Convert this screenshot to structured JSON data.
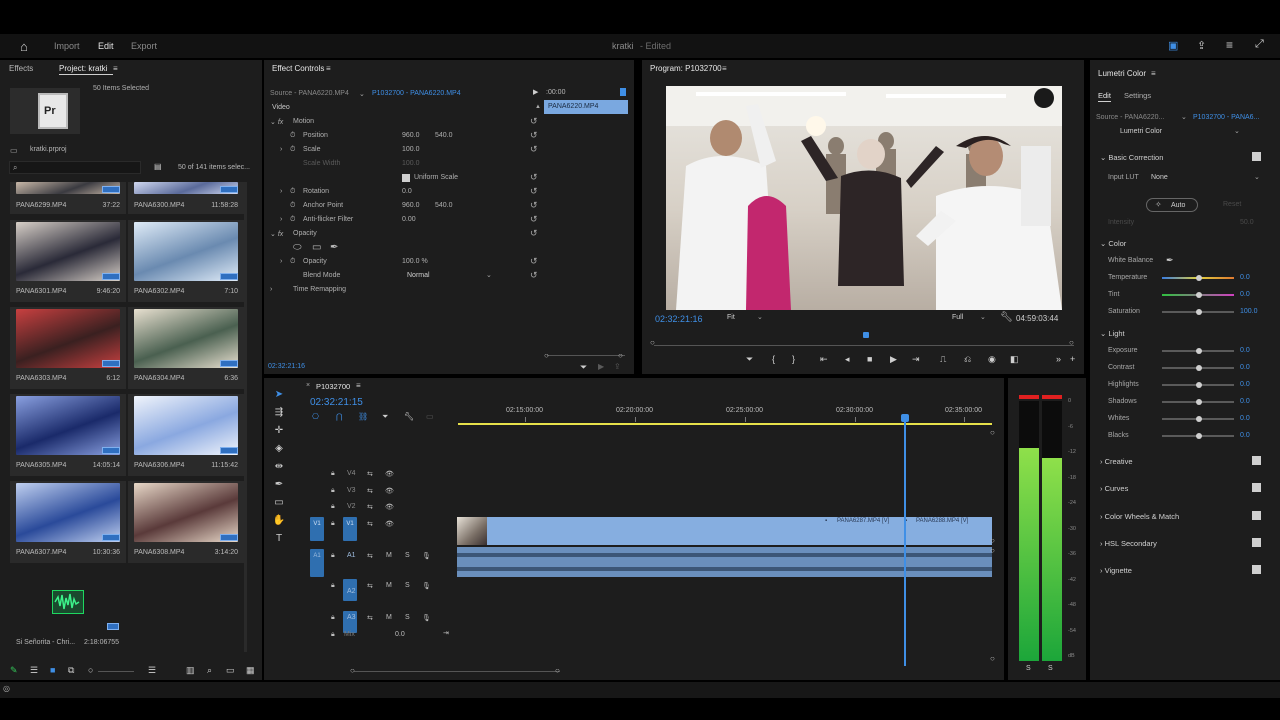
{
  "header": {
    "home": "Home",
    "import": "Import",
    "edit": "Edit",
    "export": "Export",
    "title": "kratki",
    "edited": "- Edited"
  },
  "project": {
    "tab_effects": "Effects",
    "tab_project": "Project: kratki",
    "selected": "50 Items Selected",
    "file": "kratki.prproj",
    "count": "50 of 141 items selec...",
    "items": [
      {
        "name": "PANA6299.MP4",
        "dur": "37:22"
      },
      {
        "name": "PANA6300.MP4",
        "dur": "11:58:28"
      },
      {
        "name": "PANA6301.MP4",
        "dur": "9:46:20"
      },
      {
        "name": "PANA6302.MP4",
        "dur": "7:10"
      },
      {
        "name": "PANA6303.MP4",
        "dur": "6:12"
      },
      {
        "name": "PANA6304.MP4",
        "dur": "6:36"
      },
      {
        "name": "PANA6305.MP4",
        "dur": "14:05:14"
      },
      {
        "name": "PANA6306.MP4",
        "dur": "11:15:42"
      },
      {
        "name": "PANA6307.MP4",
        "dur": "10:30:36"
      },
      {
        "name": "PANA6308.MP4",
        "dur": "3:14:20"
      }
    ],
    "audio_name": "Si Señorita - Chri...",
    "audio_dur": "2:18:06755"
  },
  "effects": {
    "tab": "Effect Controls",
    "source": "Source - PANA6220.MP4",
    "clip": "P1032700 - PANA6220.MP4",
    "time_start": ":00:00",
    "clip_label": "PANA6220.MP4",
    "video": "Video",
    "motion": "Motion",
    "position": "Position",
    "pos_x": "960.0",
    "pos_y": "540.0",
    "scale": "Scale",
    "scale_val": "100.0",
    "scale_width": "Scale Width",
    "scale_width_val": "100.0",
    "uniform": "Uniform Scale",
    "rotation": "Rotation",
    "rotation_val": "0.0",
    "anchor": "Anchor Point",
    "anc_x": "960.0",
    "anc_y": "540.0",
    "antiflicker": "Anti-flicker Filter",
    "antiflicker_val": "0.00",
    "opacity_group": "Opacity",
    "opacity": "Opacity",
    "opacity_val": "100.0 %",
    "blend": "Blend Mode",
    "blend_val": "Normal",
    "time_remap": "Time Remapping",
    "timecode": "02:32:21:16"
  },
  "program": {
    "tab": "Program: P1032700",
    "timecode": "02:32:21:16",
    "fit": "Fit",
    "full": "Full",
    "duration": "04:59:03:44"
  },
  "timeline": {
    "tab": "P1032700",
    "timecode": "02:32:21:15",
    "ruler": [
      "02:15:00:00",
      "02:20:00:00",
      "02:25:00:00",
      "02:30:00:00",
      "02:35:00:00"
    ],
    "tracks_video": [
      "V4",
      "V3",
      "V2",
      "V1"
    ],
    "tracks_audio": [
      "A1",
      "A2",
      "A3"
    ],
    "mix": "Mix",
    "mix_val": "0.0",
    "clip1": "PANA6287.MP4 [V]",
    "clip2": "PANA6288.MP4 [V]"
  },
  "meters": {
    "scale": [
      "0",
      "-6",
      "-12",
      "-18",
      "-24",
      "-30",
      "-36",
      "-42",
      "-48",
      "-54",
      "dB"
    ],
    "s_left": "S",
    "s_right": "S",
    "left_level": 0.82,
    "right_level": 0.78
  },
  "lumetri": {
    "tab": "Lumetri Color",
    "edit": "Edit",
    "settings": "Settings",
    "source": "Source - PANA6220...",
    "clip": "P1032700 - PANA6...",
    "effect": "Lumetri Color",
    "basic": "Basic Correction",
    "input_lut": "Input LUT",
    "lut_val": "None",
    "auto": "Auto",
    "reset": "Reset",
    "intensity": "Intensity",
    "intensity_val": "50.0",
    "color": "Color",
    "white_balance": "White Balance",
    "temperature": "Temperature",
    "tint": "Tint",
    "saturation": "Saturation",
    "temp_val": "0.0",
    "tint_val": "0.0",
    "sat_val": "100.0",
    "light": "Light",
    "exposure": "Exposure",
    "contrast": "Contrast",
    "highlights": "Highlights",
    "shadows": "Shadows",
    "whites": "Whites",
    "blacks": "Blacks",
    "exp_val": "0.0",
    "con_val": "0.0",
    "hi_val": "0.0",
    "sh_val": "0.0",
    "wh_val": "0.0",
    "bl_val": "0.0",
    "creative": "Creative",
    "curves": "Curves",
    "wheels": "Color Wheels & Match",
    "hsl": "HSL Secondary",
    "vignette": "Vignette"
  },
  "colors": {
    "accent": "#3f8fe6",
    "clip": "#86aee0",
    "audio": "#6a8fbc"
  }
}
